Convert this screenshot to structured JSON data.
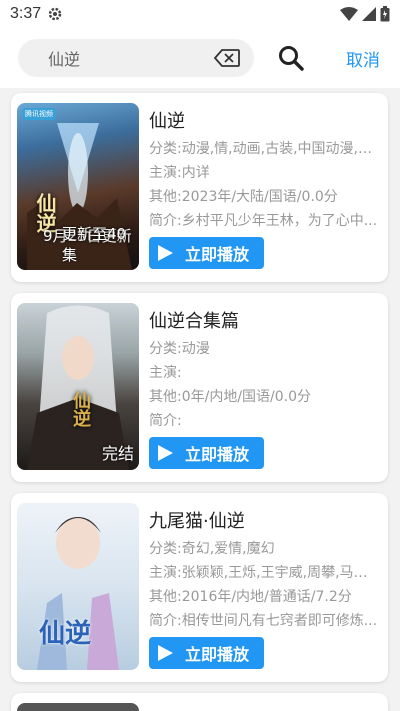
{
  "status": {
    "time": "3:37"
  },
  "search": {
    "value": "仙逆",
    "cancel_label": "取消"
  },
  "play_label": "立即播放",
  "results": [
    {
      "title": "仙逆",
      "category": "分类:动漫,情,动画,古装,中国动漫,国...",
      "cast": "主演:内详",
      "other": "其他:2023年/大陆/国语/0.0分",
      "intro": "简介:乡村平凡少年王林，为了心中...",
      "badge": "9月25日更新",
      "badge2": "更新至40集",
      "poster_text": "仙逆",
      "poster_corner": "腾讯视频"
    },
    {
      "title": "仙逆合集篇",
      "category": "分类:动漫",
      "cast": "主演:",
      "other": "其他:0年/内地/国语/0.0分",
      "intro": "简介:",
      "badge": "完结",
      "poster_text": "仙逆"
    },
    {
      "title": "九尾猫·仙逆",
      "category": "分类:奇幻,爱情,魔幻",
      "cast": "主演:张颖颖,王烁,王宇威,周攀,马瑶瑶",
      "other": "其他:2016年/内地/普通话/7.2分",
      "intro": "简介:相传世间凡有七窍者即可修炼...",
      "badge": "",
      "poster_text": "仙逆"
    }
  ]
}
